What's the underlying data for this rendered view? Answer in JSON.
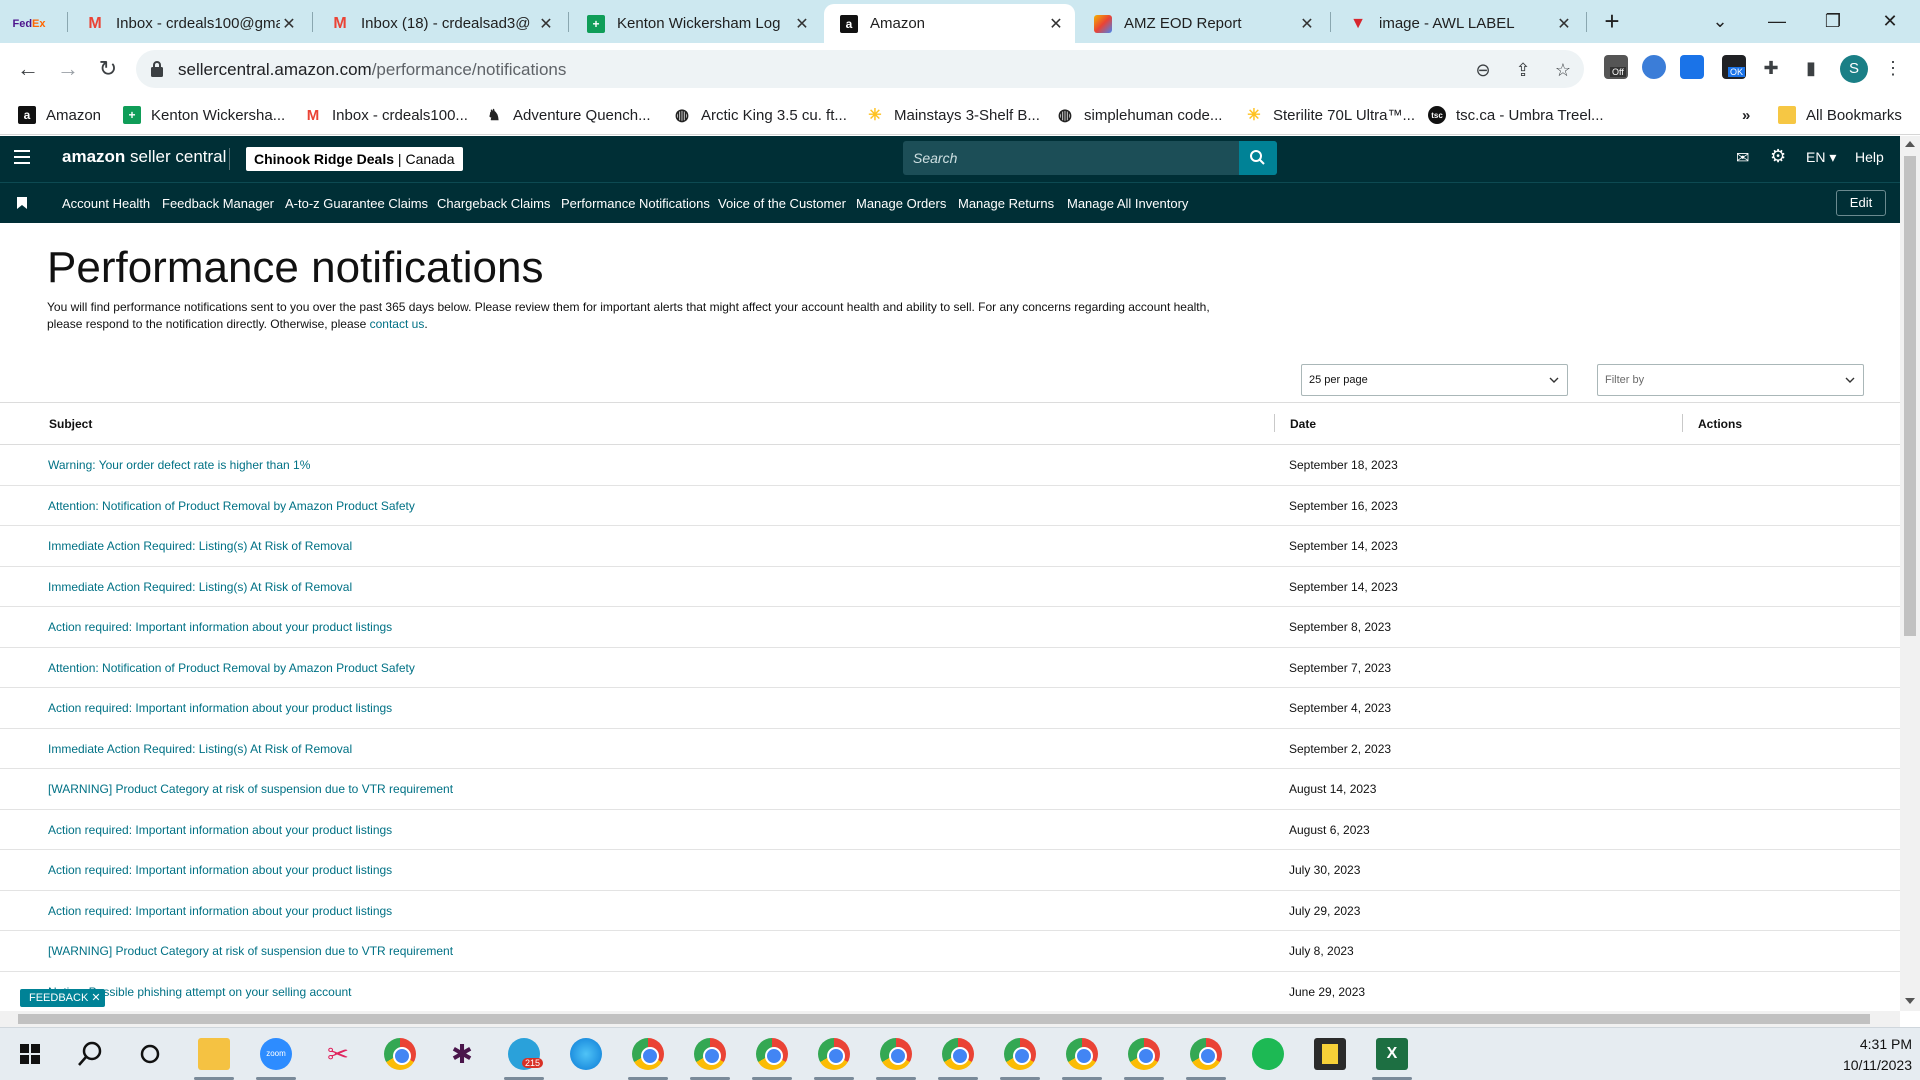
{
  "browser": {
    "tabs": [
      {
        "label": "",
        "icon": "fedex-icon"
      },
      {
        "label": "Inbox - crdeals100@gmai",
        "icon": "gmail-icon"
      },
      {
        "label": "Inbox (18) - crdealsad3@",
        "icon": "gmail-icon"
      },
      {
        "label": "Kenton Wickersham Log",
        "icon": "google-sheets-icon"
      },
      {
        "label": "Amazon",
        "icon": "amazon-icon"
      },
      {
        "label": "AMZ EOD Report",
        "icon": "report-icon"
      },
      {
        "label": "image - AWL LABEL",
        "icon": "awl-icon"
      }
    ],
    "url_domain": "sellercentral.amazon.com",
    "url_path": "/performance/notifications",
    "profile_initial": "S",
    "extension_off_badge": "Off",
    "extension_ok_badge": "OK",
    "bookmarks": [
      {
        "label": "Amazon",
        "icon": "amazon-icon"
      },
      {
        "label": "Kenton Wickersha...",
        "icon": "google-sheets-icon"
      },
      {
        "label": "Inbox - crdeals100...",
        "icon": "gmail-icon"
      },
      {
        "label": "Adventure Quench...",
        "icon": "moose-icon"
      },
      {
        "label": "Arctic King 3.5 cu. ft...",
        "icon": "globe-icon"
      },
      {
        "label": "Mainstays 3-Shelf B...",
        "icon": "walmart-icon"
      },
      {
        "label": "simplehuman code...",
        "icon": "globe-icon"
      },
      {
        "label": "Sterilite 70L Ultra™...",
        "icon": "walmart-icon"
      },
      {
        "label": "tsc.ca - Umbra Treel...",
        "icon": "tsc-icon"
      }
    ],
    "bookmarks_more": "»",
    "all_bookmarks": "All Bookmarks"
  },
  "header": {
    "logo_bold": "amazon",
    "logo_rest": " seller central",
    "store_name": "Chinook Ridge Deals",
    "store_region": "Canada",
    "search_placeholder": "Search",
    "language": "EN",
    "help": "Help"
  },
  "nav": {
    "items": [
      "Account Health",
      "Feedback Manager",
      "A-to-z Guarantee Claims",
      "Chargeback Claims",
      "Performance Notifications",
      "Voice of the Customer",
      "Manage Orders",
      "Manage Returns",
      "Manage All Inventory"
    ],
    "edit": "Edit"
  },
  "page": {
    "title": "Performance notifications",
    "description": "You will find performance notifications sent to you over the past 365 days below. Please review them for important alerts that might affect your account health and ability to sell. For any concerns regarding account health, please respond to the notification directly. Otherwise, please ",
    "contact_link": "contact us",
    "description_end": ".",
    "per_page": "25 per page",
    "filter_placeholder": "Filter by",
    "columns": {
      "subject": "Subject",
      "date": "Date",
      "actions": "Actions"
    },
    "rows": [
      {
        "subject": "Warning: Your order defect rate is higher than 1%",
        "date": "September 18, 2023"
      },
      {
        "subject": "Attention: Notification of Product Removal by Amazon Product Safety",
        "date": "September 16, 2023"
      },
      {
        "subject": "Immediate Action Required: Listing(s) At Risk of Removal",
        "date": "September 14, 2023"
      },
      {
        "subject": "Immediate Action Required: Listing(s) At Risk of Removal",
        "date": "September 14, 2023"
      },
      {
        "subject": "Action required: Important information about your product listings",
        "date": "September 8, 2023"
      },
      {
        "subject": "Attention: Notification of Product Removal by Amazon Product Safety",
        "date": "September 7, 2023"
      },
      {
        "subject": "Action required: Important information about your product listings",
        "date": "September 4, 2023"
      },
      {
        "subject": "Immediate Action Required: Listing(s) At Risk of Removal",
        "date": "September 2, 2023"
      },
      {
        "subject": "[WARNING] Product Category at risk of suspension due to VTR requirement",
        "date": "August 14, 2023"
      },
      {
        "subject": "Action required: Important information about your product listings",
        "date": "August 6, 2023"
      },
      {
        "subject": "Action required: Important information about your product listings",
        "date": "July 30, 2023"
      },
      {
        "subject": "Action required: Important information about your product listings",
        "date": "July 29, 2023"
      },
      {
        "subject": "[WARNING] Product Category at risk of suspension due to VTR requirement",
        "date": "July 8, 2023"
      },
      {
        "subject": "Notice: Possible phishing attempt on your selling account",
        "date": "June 29, 2023"
      }
    ],
    "feedback": "FEEDBACK"
  },
  "taskbar": {
    "time": "4:31 PM",
    "date": "10/11/2023",
    "telegram_badge": "215"
  },
  "colors": {
    "header_bg": "#002f36",
    "link": "#007185",
    "accent": "#008296",
    "tab_strip": "#cde8f0"
  }
}
